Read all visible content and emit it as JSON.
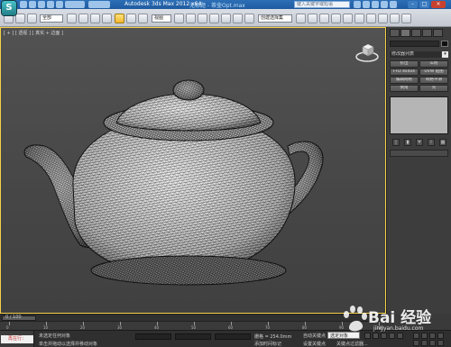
{
  "window": {
    "title": "Autodesk 3ds Max  2012 x64",
    "file": "无标题 - 茶壶Opt.max",
    "search_placeholder": "键入关键字或短语",
    "logo_letter": "S",
    "minimize": "–",
    "maximize": "□",
    "close": "×"
  },
  "toolbar": {
    "selection_filter": "全部",
    "reference_coord": "视图",
    "named_selection": "创建选择集"
  },
  "viewport": {
    "label": "[ + ] [ 透视 ] [ 真实 + 边面 ]",
    "viewcube_icon": "viewcube-icon",
    "object": "teapot"
  },
  "command_panel": {
    "object_name": "",
    "modifier_list": "修改器列表",
    "dropdown_arrow": "▾",
    "buttons": [
      "挤出",
      "车削",
      "FFD 4x4x4",
      "UVW 贴图",
      "编辑网格",
      "网格平滑",
      "倒角",
      "壳"
    ],
    "stack_controls": [
      "|",
      "▮",
      "∀",
      "ⅰ",
      "▦"
    ]
  },
  "timeline": {
    "frame_label": "0 / 100",
    "ticks": [
      0,
      10,
      20,
      30,
      40,
      50,
      60,
      70,
      80,
      90,
      100
    ]
  },
  "status": {
    "max_script_button": "再在行：",
    "selected_info": "未选定任何对象",
    "prompt_info": "单击并拖动以选择并移动对象",
    "grid_info": "栅格 = 254.0mm",
    "add_time_tag": "添加时间标记",
    "auto_key": "自动关键点",
    "set_key": "设置关键点",
    "selected_object": "选定对象",
    "key_filters": "关键点过滤器..."
  },
  "watermark": {
    "brand": "Bai  经验",
    "sub": "jingyan.baidu.com"
  },
  "colors": {
    "title_bar": "#2d6fb6",
    "viewport_border": "#f6d047",
    "viewport_bg": "#4a4a4a",
    "panel_bg": "#3d3d3d"
  }
}
